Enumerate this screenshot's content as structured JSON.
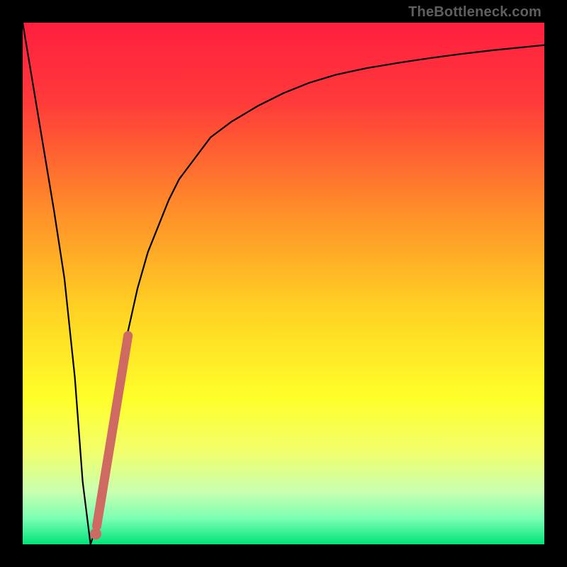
{
  "watermark": "TheBottleneck.com",
  "chart_data": {
    "type": "line",
    "title": "",
    "xlabel": "",
    "ylabel": "",
    "xlim": [
      0,
      100
    ],
    "ylim": [
      0,
      100
    ],
    "gradient_stops": [
      {
        "offset": 0.0,
        "color": "#ff1f3f"
      },
      {
        "offset": 0.15,
        "color": "#ff3a3a"
      },
      {
        "offset": 0.35,
        "color": "#ff8a2a"
      },
      {
        "offset": 0.55,
        "color": "#ffd223"
      },
      {
        "offset": 0.72,
        "color": "#ffff2a"
      },
      {
        "offset": 0.82,
        "color": "#f3ff6a"
      },
      {
        "offset": 0.9,
        "color": "#c8ffb0"
      },
      {
        "offset": 0.95,
        "color": "#7dffb4"
      },
      {
        "offset": 1.0,
        "color": "#00e37a"
      }
    ],
    "series": [
      {
        "name": "bottleneck-curve",
        "stroke": "#000000",
        "stroke_width": 2.2,
        "x": [
          0,
          2,
          4,
          6,
          8,
          10,
          11.5,
          13,
          14,
          15,
          16,
          18,
          20,
          22,
          24,
          26,
          28,
          30,
          33,
          36,
          40,
          45,
          50,
          55,
          60,
          66,
          72,
          78,
          84,
          90,
          96,
          100
        ],
        "y": [
          100,
          88,
          76,
          64,
          51,
          32,
          12,
          0,
          3,
          8,
          15,
          28,
          40,
          49,
          56,
          61,
          66,
          70,
          74,
          78,
          81,
          84,
          86.5,
          88.5,
          90,
          91.3,
          92.3,
          93.2,
          94,
          94.7,
          95.3,
          95.7
        ]
      },
      {
        "name": "highlight-segment",
        "stroke": "#cf6a62",
        "stroke_width": 13,
        "linecap": "round",
        "x": [
          14.2,
          20.2
        ],
        "y": [
          3.5,
          40
        ]
      }
    ],
    "markers": [
      {
        "name": "highlight-end-dot",
        "x": 14.0,
        "y": 2.0,
        "r": 8,
        "fill": "#cf6a62"
      }
    ]
  }
}
